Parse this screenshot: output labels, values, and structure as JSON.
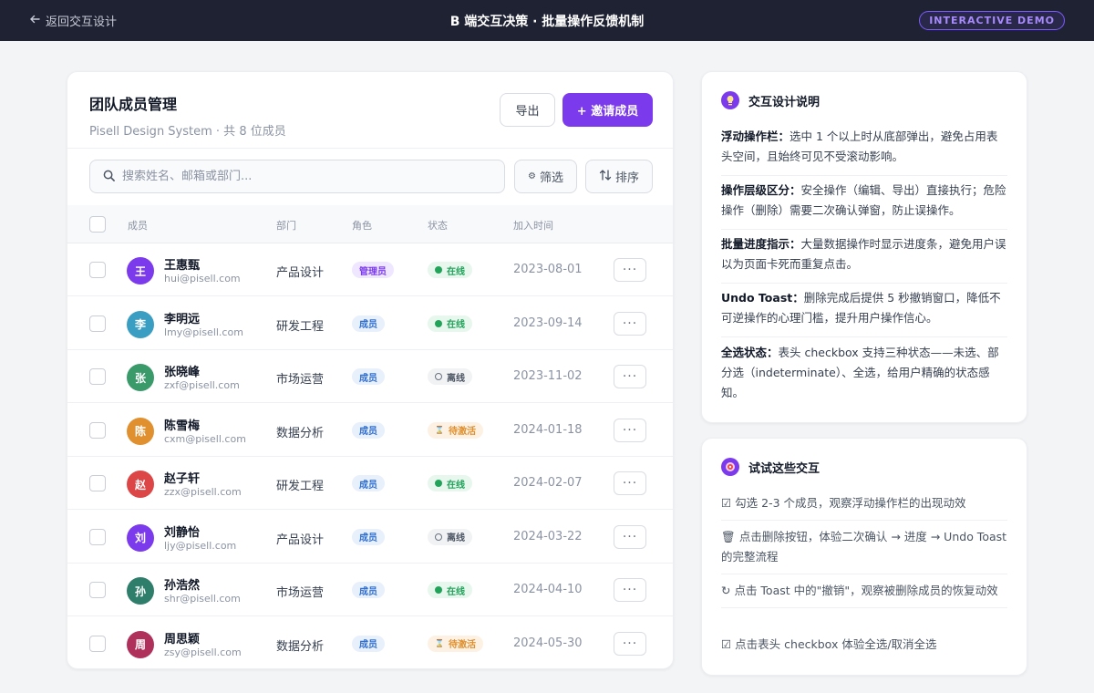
{
  "topbar": {
    "back_label": "返回交互设计",
    "title": "B 端交互决策 · 批量操作反馈机制",
    "badge": "INTERACTIVE DEMO"
  },
  "panel": {
    "title": "团队成员管理",
    "subtitle": "Pisell Design System · 共 8 位成员",
    "export_label": "导出",
    "invite_label": "+ 邀请成员",
    "search_placeholder": "搜索姓名、邮箱或部门...",
    "filter_label": "筛选",
    "sort_label": "排序"
  },
  "table": {
    "headers": {
      "member": "成员",
      "dept": "部门",
      "role": "角色",
      "status": "状态",
      "joined": "加入时间"
    },
    "rows": [
      {
        "initial": "王",
        "name": "王惠甄",
        "email": "hui@pisell.com",
        "dept": "产品设计",
        "role": "管理员",
        "status": "在线",
        "date": "2023-08-01",
        "avatar_color": "#7c3aed",
        "role_type": "admin",
        "status_type": "online"
      },
      {
        "initial": "李",
        "name": "李明远",
        "email": "lmy@pisell.com",
        "dept": "研发工程",
        "role": "成员",
        "status": "在线",
        "date": "2023-09-14",
        "avatar_color": "#3a9ec2",
        "role_type": "member",
        "status_type": "online"
      },
      {
        "initial": "张",
        "name": "张晓峰",
        "email": "zxf@pisell.com",
        "dept": "市场运营",
        "role": "成员",
        "status": "离线",
        "date": "2023-11-02",
        "avatar_color": "#3a9a6a",
        "role_type": "member",
        "status_type": "offline"
      },
      {
        "initial": "陈",
        "name": "陈雪梅",
        "email": "cxm@pisell.com",
        "dept": "数据分析",
        "role": "成员",
        "status": "待激活",
        "date": "2024-01-18",
        "avatar_color": "#e0902e",
        "role_type": "member",
        "status_type": "pending"
      },
      {
        "initial": "赵",
        "name": "赵子轩",
        "email": "zzx@pisell.com",
        "dept": "研发工程",
        "role": "成员",
        "status": "在线",
        "date": "2024-02-07",
        "avatar_color": "#dc4646",
        "role_type": "member",
        "status_type": "online"
      },
      {
        "initial": "刘",
        "name": "刘静怡",
        "email": "ljy@pisell.com",
        "dept": "产品设计",
        "role": "成员",
        "status": "离线",
        "date": "2024-03-22",
        "avatar_color": "#7c3aed",
        "role_type": "member",
        "status_type": "offline"
      },
      {
        "initial": "孙",
        "name": "孙浩然",
        "email": "shr@pisell.com",
        "dept": "市场运营",
        "role": "成员",
        "status": "在线",
        "date": "2024-04-10",
        "avatar_color": "#2f7d6b",
        "role_type": "member",
        "status_type": "online"
      },
      {
        "initial": "周",
        "name": "周思颖",
        "email": "zsy@pisell.com",
        "dept": "数据分析",
        "role": "成员",
        "status": "待激活",
        "date": "2024-05-30",
        "avatar_color": "#b0305c",
        "role_type": "member",
        "status_type": "pending"
      }
    ]
  },
  "design_notes": {
    "title": "交互设计说明",
    "items": [
      {
        "head": "浮动操作栏：",
        "body": "选中 1 个以上时从底部弹出，避免占用表头空间，且始终可见不受滚动影响。"
      },
      {
        "head": "操作层级区分：",
        "body": "安全操作（编辑、导出）直接执行；危险操作（删除）需要二次确认弹窗，防止误操作。"
      },
      {
        "head": "批量进度指示：",
        "body": "大量数据操作时显示进度条，避免用户误以为页面卡死而重复点击。"
      },
      {
        "head": "Undo Toast：",
        "body": "删除完成后提供 5 秒撤销窗口，降低不可逆操作的心理门槛，提升用户操作信心。"
      },
      {
        "head": "全选状态：",
        "body": "表头 checkbox 支持三种状态——未选、部分选（indeterminate）、全选，给用户精确的状态感知。"
      }
    ]
  },
  "try_panel": {
    "title": "试试这些交互",
    "items": [
      "☑ 勾选 2-3 个成员，观察浮动操作栏的出现动效",
      "🗑 点击删除按钮，体验二次确认 → 进度 → Undo Toast 的完整流程",
      "↻ 点击 Toast 中的\"撤销\"，观察被删除成员的恢复动效",
      "☑ 点击表头 checkbox 体验全选/取消全选"
    ]
  },
  "colors": {
    "accent": "#7c3aed",
    "topbar": "#1e2233",
    "online": "#22a35a",
    "pending": "#e0902e"
  }
}
